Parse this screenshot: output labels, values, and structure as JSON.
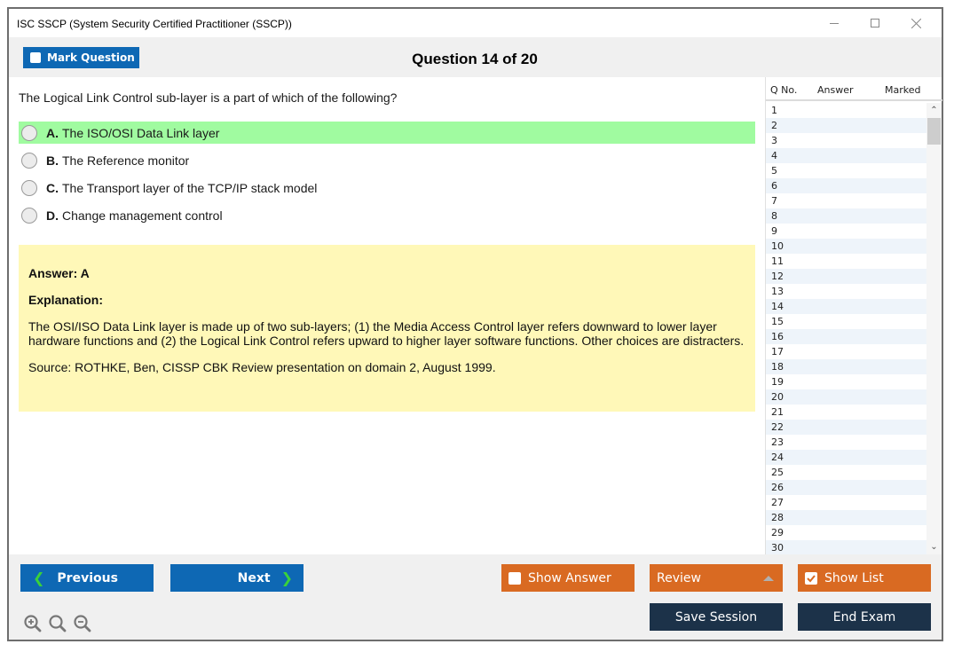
{
  "window": {
    "title": "ISC SSCP (System Security Certified Practitioner (SSCP))",
    "controls": {
      "minimize": "minimize-icon",
      "maximize": "maximize-icon",
      "close": "close-icon"
    }
  },
  "header": {
    "mark_question_label": "Mark Question",
    "mark_question_checked": false,
    "question_counter": "Question 14 of 20"
  },
  "question": {
    "text": "The Logical Link Control sub-layer is a part of which of the following?",
    "options": [
      {
        "letter": "A.",
        "text": "The ISO/OSI Data Link layer",
        "correct": true
      },
      {
        "letter": "B.",
        "text": "The Reference monitor",
        "correct": false
      },
      {
        "letter": "C.",
        "text": "The Transport layer of the TCP/IP stack model",
        "correct": false
      },
      {
        "letter": "D.",
        "text": "Change management control",
        "correct": false
      }
    ]
  },
  "answer_panel": {
    "answer": "Answer: A",
    "explanation_title": "Explanation:",
    "explanation_body": "The OSI/ISO Data Link layer is made up of two sub-layers; (1) the Media Access Control layer refers downward to lower layer hardware functions and (2) the Logical Link Control refers upward to higher layer software functions. Other choices are distracters.",
    "source": "Source: ROTHKE, Ben, CISSP CBK Review presentation on domain 2, August 1999.",
    "background_color": "#fff8b8"
  },
  "question_list": {
    "headers": {
      "qno": "Q No.",
      "answer": "Answer",
      "marked": "Marked"
    },
    "rows": [
      "1",
      "2",
      "3",
      "4",
      "5",
      "6",
      "7",
      "8",
      "9",
      "10",
      "11",
      "12",
      "13",
      "14",
      "15",
      "16",
      "17",
      "18",
      "19",
      "20",
      "21",
      "22",
      "23",
      "24",
      "25",
      "26",
      "27",
      "28",
      "29",
      "30"
    ]
  },
  "footer": {
    "previous_label": "Previous",
    "next_label": "Next",
    "show_answer_label": "Show Answer",
    "show_answer_checked": false,
    "review_label": "Review",
    "show_list_label": "Show List",
    "show_list_checked": true,
    "save_session_label": "Save Session",
    "end_exam_label": "End Exam",
    "zoom_icons": [
      "zoom-in-icon",
      "zoom-reset-icon",
      "zoom-out-icon"
    ]
  },
  "colors": {
    "primary_blue": "#0e68b4",
    "orange": "#d96a22",
    "navy": "#1c3249",
    "correct_green": "#a0fba0",
    "chevron_green": "#3ad23a"
  }
}
